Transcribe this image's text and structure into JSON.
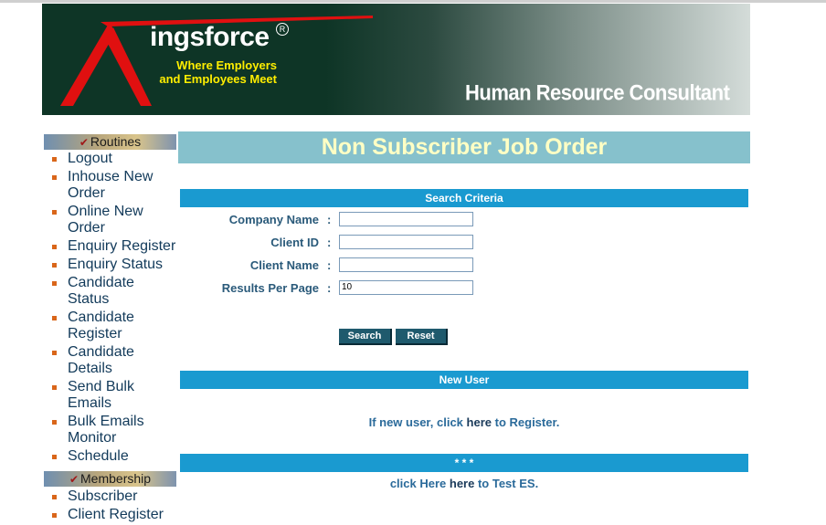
{
  "banner": {
    "brand_name": "ingsforce",
    "registered_mark": "R",
    "tagline_line1": "Where Employers",
    "tagline_line2": "and Employees Meet",
    "subtitle": "Human Resource Consultant"
  },
  "sidebar": {
    "routines_header": "Routines",
    "routines_items": [
      {
        "label": "Logout"
      },
      {
        "label": "Inhouse New Order"
      },
      {
        "label": "Online New Order"
      },
      {
        "label": "Enquiry Register"
      },
      {
        "label": "Enquiry Status"
      },
      {
        "label": "Candidate Status"
      },
      {
        "label": "Candidate Register"
      },
      {
        "label": "Candidate Details"
      },
      {
        "label": "Send Bulk Emails"
      },
      {
        "label": "Bulk Emails Monitor"
      },
      {
        "label": "Schedule"
      }
    ],
    "membership_header": "Membership",
    "membership_items": [
      {
        "label": "Subscriber"
      },
      {
        "label": "Client Register"
      }
    ]
  },
  "main": {
    "title": "Non Subscriber Job Order",
    "search_criteria_header": "Search Criteria",
    "fields": {
      "company_name": {
        "label": "Company Name",
        "value": ""
      },
      "client_id": {
        "label": "Client ID",
        "value": ""
      },
      "client_name": {
        "label": "Client Name",
        "value": ""
      },
      "results_per_page": {
        "label": "Results Per Page",
        "value": "10"
      }
    },
    "colon": ":",
    "search_button": "Search",
    "reset_button": "Reset",
    "new_user_header": "New User",
    "register_text_pre": "If new user, click",
    "register_link": "here",
    "register_text_post": "to Register.",
    "third_header": "* * *",
    "test_link": "click Here",
    "test_text_mid": "here",
    "test_text_post": "to Test ES."
  },
  "colors": {
    "banner_dark": "#0e3526",
    "title_bar": "#86c1cc",
    "title_text": "#ffffc4",
    "section_bar": "#1a9ad0",
    "button_bg": "#1f5a6d",
    "bullet": "#d9661a"
  }
}
